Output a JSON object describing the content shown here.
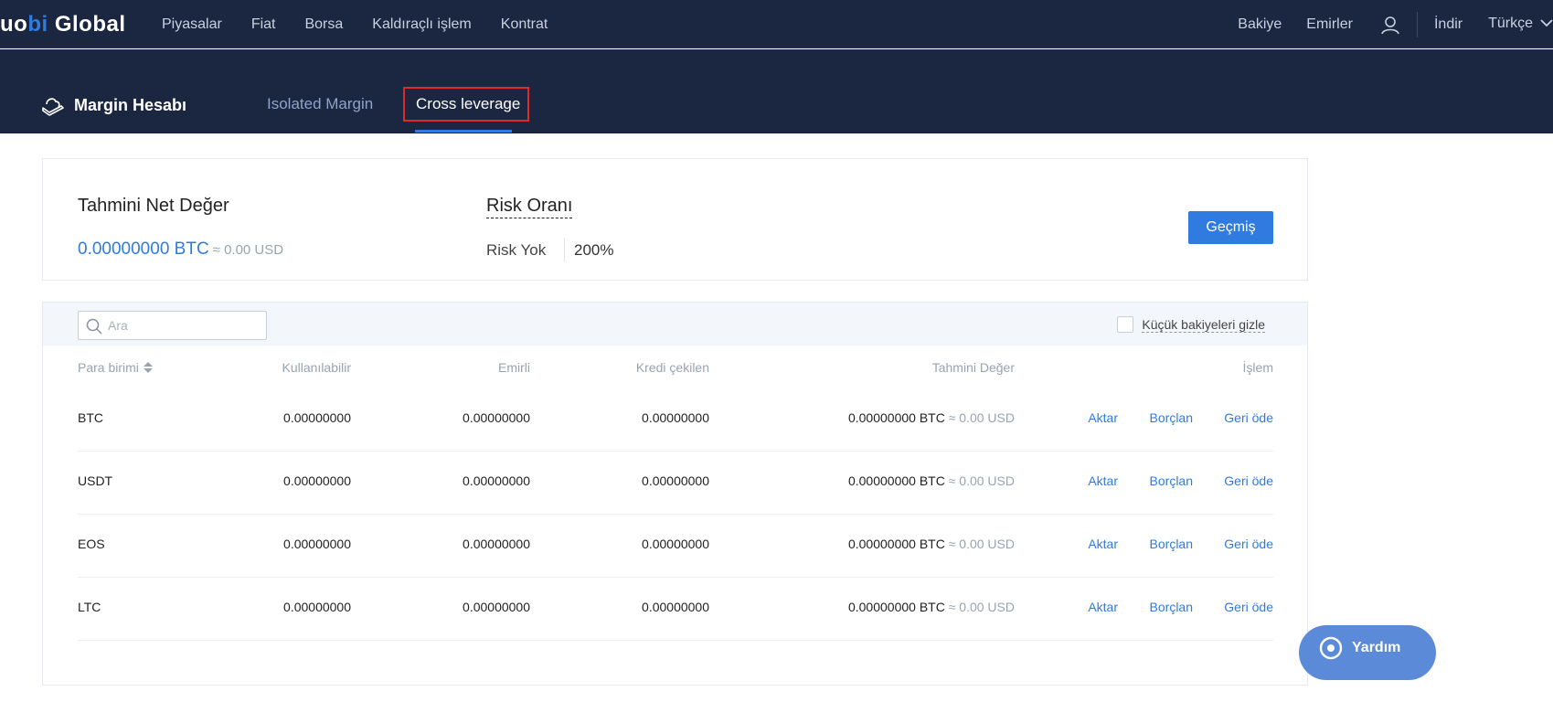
{
  "nav": {
    "logo_prefix": "uo",
    "logo_highlight": "bi",
    "logo_suffix": " Global",
    "left_items": [
      "Piyasalar",
      "Fiat",
      "Borsa",
      "Kaldıraçlı işlem",
      "Kontrat"
    ],
    "balance": "Bakiye",
    "orders": "Emirler",
    "download": "İndir",
    "language": "Türkçe"
  },
  "header": {
    "title": "Margin Hesabı",
    "tabs": [
      {
        "label": "Isolated Margin",
        "active": false
      },
      {
        "label": "Cross leverage",
        "active": true
      }
    ]
  },
  "summary": {
    "net_value_label": "Tahmini Net Değer",
    "net_value_btc": "0.00000000 BTC",
    "net_value_usd": "≈ 0.00 USD",
    "risk_label": "Risk Oranı",
    "risk_status": "Risk Yok",
    "risk_value": "200%",
    "history_button": "Geçmiş"
  },
  "toolbar": {
    "search_placeholder": "Ara",
    "hide_small_label": "Küçük bakiyeleri gizle",
    "hide_small_checked": false
  },
  "table": {
    "columns": {
      "currency": "Para birimi",
      "available": "Kullanılabilir",
      "in_orders": "Emirli",
      "borrowed": "Kredi çekilen",
      "estimated": "Tahmini Değer",
      "actions": "İşlem"
    },
    "rows": [
      {
        "currency": "BTC",
        "available": "0.00000000",
        "in_orders": "0.00000000",
        "borrowed": "0.00000000",
        "est_btc": "0.00000000 BTC",
        "est_usd": "≈ 0.00 USD"
      },
      {
        "currency": "USDT",
        "available": "0.00000000",
        "in_orders": "0.00000000",
        "borrowed": "0.00000000",
        "est_btc": "0.00000000 BTC",
        "est_usd": "≈ 0.00 USD"
      },
      {
        "currency": "EOS",
        "available": "0.00000000",
        "in_orders": "0.00000000",
        "borrowed": "0.00000000",
        "est_btc": "0.00000000 BTC",
        "est_usd": "≈ 0.00 USD"
      },
      {
        "currency": "LTC",
        "available": "0.00000000",
        "in_orders": "0.00000000",
        "borrowed": "0.00000000",
        "est_btc": "0.00000000 BTC",
        "est_usd": "≈ 0.00 USD"
      }
    ],
    "actions": {
      "transfer": "Aktar",
      "borrow": "Borçlan",
      "repay": "Geri öde"
    }
  },
  "help": {
    "label": "Yardım"
  },
  "colors": {
    "nav_bg": "#1b2640",
    "accent": "#2f7be0",
    "highlight": "#e02a2a"
  }
}
